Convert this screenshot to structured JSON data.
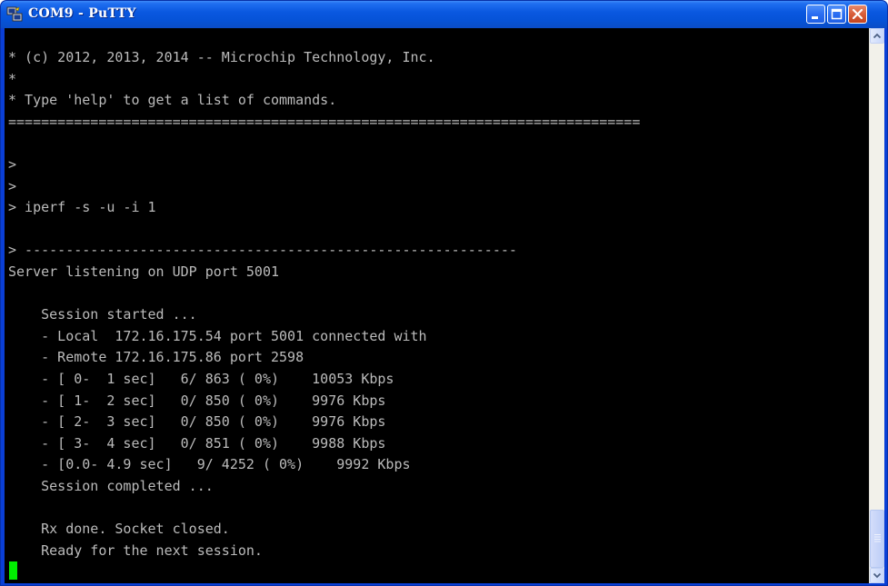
{
  "window": {
    "title": "COM9 - PuTTY"
  },
  "titlebar": {
    "icons": [
      "putty-app-icon",
      "minimize-icon",
      "maximize-icon",
      "close-icon"
    ]
  },
  "terminal": {
    "lines": [
      "* (c) 2012, 2013, 2014 -- Microchip Technology, Inc.",
      "*",
      "* Type 'help' to get a list of commands.",
      "=============================================================================",
      "",
      ">",
      ">",
      "> iperf -s -u -i 1",
      "",
      "> ------------------------------------------------------------",
      "Server listening on UDP port 5001",
      "",
      "    Session started ...",
      "    - Local  172.16.175.54 port 5001 connected with",
      "    - Remote 172.16.175.86 port 2598",
      "    - [ 0-  1 sec]   6/ 863 ( 0%)    10053 Kbps",
      "    - [ 1-  2 sec]   0/ 850 ( 0%)    9976 Kbps",
      "    - [ 2-  3 sec]   0/ 850 ( 0%)    9976 Kbps",
      "    - [ 3-  4 sec]   0/ 851 ( 0%)    9988 Kbps",
      "    - [0.0- 4.9 sec]   9/ 4252 ( 0%)    9992 Kbps",
      "    Session completed ...",
      "",
      "    Rx done. Socket closed.",
      "    Ready for the next session."
    ],
    "cursor_color": "#00ee00",
    "background": "#000000",
    "foreground": "#bbbbbb"
  },
  "scrollbar": {
    "icons": [
      "scroll-up-icon",
      "scroll-down-icon"
    ]
  },
  "colors": {
    "titlebar_blue": "#0a58e0",
    "close_red": "#d85e3a"
  }
}
